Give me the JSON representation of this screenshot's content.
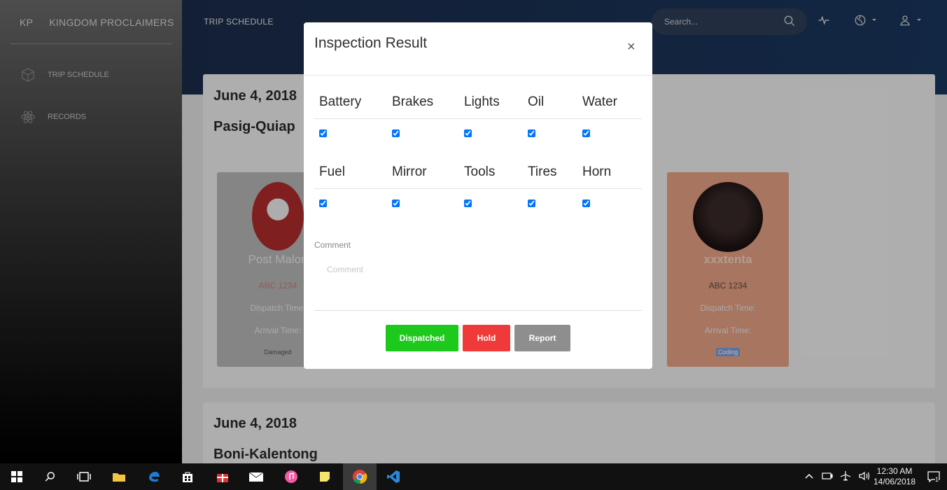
{
  "sidebar": {
    "brand_mini": "KP",
    "brand_full": "KINGDOM PROCLAIMERS",
    "items": [
      {
        "label": "TRIP SCHEDULE",
        "icon": "cube-icon"
      },
      {
        "label": "RECORDS",
        "icon": "atom-icon"
      }
    ]
  },
  "header": {
    "page_label": "TRIP SCHEDULE",
    "search_placeholder": "Search..."
  },
  "cards": [
    {
      "date": "June 4, 2018",
      "route": "Pasig-Quiap"
    },
    {
      "date": "June 4, 2018",
      "route": "Boni-Kalentong"
    }
  ],
  "drivers": [
    {
      "name": "Post Malon",
      "plate": "ABC 1234",
      "dispatch_label": "Dispatch Time:",
      "arrival_label": "Arrival Time:",
      "status": "Damaged"
    },
    {
      "name": "xxxtenta",
      "plate": "ABC 1234",
      "dispatch_label": "Dispatch Time:",
      "arrival_label": "Arrival Time:",
      "status": "Coding"
    }
  ],
  "modal": {
    "title": "Inspection Result",
    "close": "×",
    "checks_row1": [
      {
        "label": "Battery",
        "checked": true
      },
      {
        "label": "Brakes",
        "checked": true
      },
      {
        "label": "Lights",
        "checked": true
      },
      {
        "label": "Oil",
        "checked": true
      },
      {
        "label": "Water",
        "checked": true
      }
    ],
    "checks_row2": [
      {
        "label": "Fuel",
        "checked": true
      },
      {
        "label": "Mirror",
        "checked": true
      },
      {
        "label": "Tools",
        "checked": true
      },
      {
        "label": "Tires",
        "checked": true
      },
      {
        "label": "Horn",
        "checked": true
      }
    ],
    "comment_label": "Comment",
    "comment_placeholder": "Comment",
    "buttons": {
      "dispatched": "Dispatched",
      "hold": "Hold",
      "report": "Report"
    },
    "colors": {
      "dispatched": "#1ec91e",
      "hold": "#f03a3a",
      "report": "#8e8e8e"
    }
  },
  "taskbar": {
    "time": "12:30 AM",
    "date": "14/06/2018",
    "notification_count": "1"
  }
}
